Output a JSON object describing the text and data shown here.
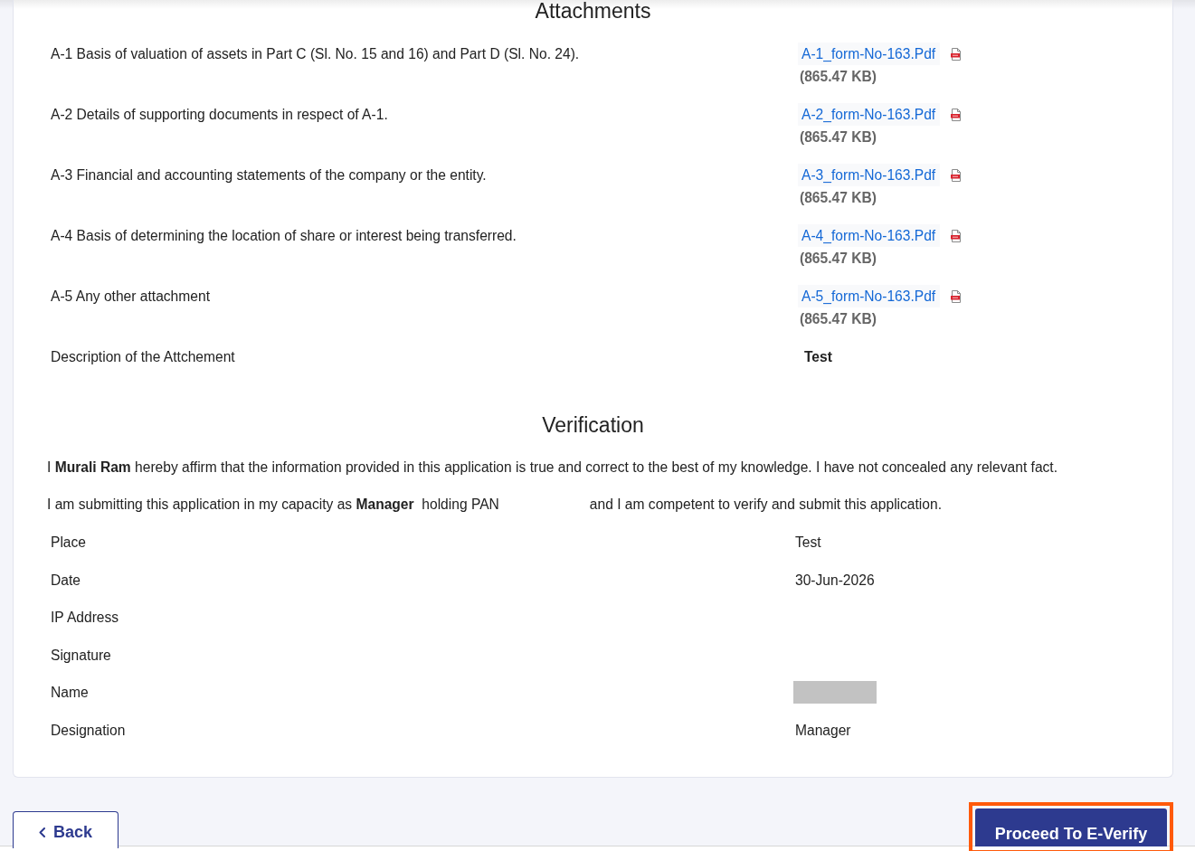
{
  "attachments": {
    "title": "Attachments",
    "items": [
      {
        "label": "A-1 Basis of valuation of assets in Part C (Sl. No. 15 and 16) and Part D (Sl. No. 24).",
        "file_name": "A-1_form-No-163.Pdf",
        "file_size": "(865.47 KB)"
      },
      {
        "label": "A-2 Details of supporting documents in respect of A-1.",
        "file_name": "A-2_form-No-163.Pdf",
        "file_size": "(865.47 KB)"
      },
      {
        "label": "A-3 Financial and accounting statements of the company or the entity.",
        "file_name": "A-3_form-No-163.Pdf",
        "file_size": "(865.47 KB)"
      },
      {
        "label": "A-4 Basis of determining the location of share or interest being transferred.",
        "file_name": "A-4_form-No-163.Pdf",
        "file_size": "(865.47 KB)"
      },
      {
        "label": "A-5 Any other attachment",
        "file_name": "A-5_form-No-163.Pdf",
        "file_size": "(865.47 KB)"
      }
    ],
    "description": {
      "label": "Description of the Attchement",
      "value": "Test"
    }
  },
  "verification": {
    "title": "Verification",
    "declaration": "I **Murali Ram** hereby affirm that the information provided in this application is true and correct to the best of my knowledge. I have not concealed any relevant fact.",
    "capacity_statement": {
      "before_pan": "I am submitting this application in my capacity as **Manager**  holding PAN",
      "after_pan": "and I am competent to verify and submit this application."
    },
    "fields": [
      {
        "label": "Place",
        "value": "Test"
      },
      {
        "label": "Date",
        "value": "30-Jun-2026"
      },
      {
        "label": "IP Address"
      },
      {
        "label": "Signature"
      },
      {
        "label": "Name",
        "redacted": true
      },
      {
        "label": "Designation",
        "value": "Manager"
      }
    ]
  },
  "buttons": [
    {
      "kind": "back",
      "label": "Back"
    },
    {
      "kind": "primary",
      "label": "Proceed To E-Verify",
      "highlighted": true
    }
  ]
}
